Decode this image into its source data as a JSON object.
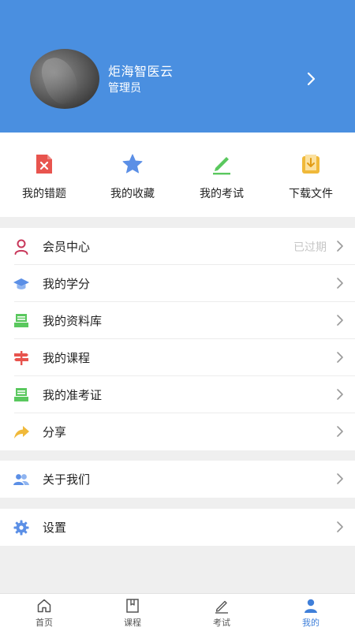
{
  "profile": {
    "name": "炬海智医云",
    "role": "管理员"
  },
  "quick_actions": [
    {
      "label": "我的错题",
      "icon": "wrong-questions-icon"
    },
    {
      "label": "我的收藏",
      "icon": "star-icon"
    },
    {
      "label": "我的考试",
      "icon": "pen-icon"
    },
    {
      "label": "下载文件",
      "icon": "download-file-icon"
    }
  ],
  "menu_group_1": [
    {
      "label": "会员中心",
      "status": "已过期",
      "icon": "user-icon"
    },
    {
      "label": "我的学分",
      "icon": "graduation-cap-icon"
    },
    {
      "label": "我的资料库",
      "icon": "library-icon"
    },
    {
      "label": "我的课程",
      "icon": "signpost-icon"
    },
    {
      "label": "我的准考证",
      "icon": "admission-ticket-icon"
    },
    {
      "label": "分享",
      "icon": "share-icon"
    }
  ],
  "menu_group_2": [
    {
      "label": "关于我们",
      "icon": "people-icon"
    }
  ],
  "menu_group_3": [
    {
      "label": "设置",
      "icon": "gear-icon"
    }
  ],
  "tabbar": [
    {
      "label": "首页",
      "icon": "home-icon"
    },
    {
      "label": "课程",
      "icon": "book-icon"
    },
    {
      "label": "考试",
      "icon": "edit-icon"
    },
    {
      "label": "我的",
      "icon": "person-icon",
      "active": true
    }
  ],
  "colors": {
    "header_bg": "#4a8fe0",
    "active_tab": "#3f7fd9",
    "red": "#e8544e",
    "blue": "#5b8fe6",
    "green": "#5ac85e",
    "yellow": "#f0b93a",
    "expired_text": "#c6c6c6"
  }
}
